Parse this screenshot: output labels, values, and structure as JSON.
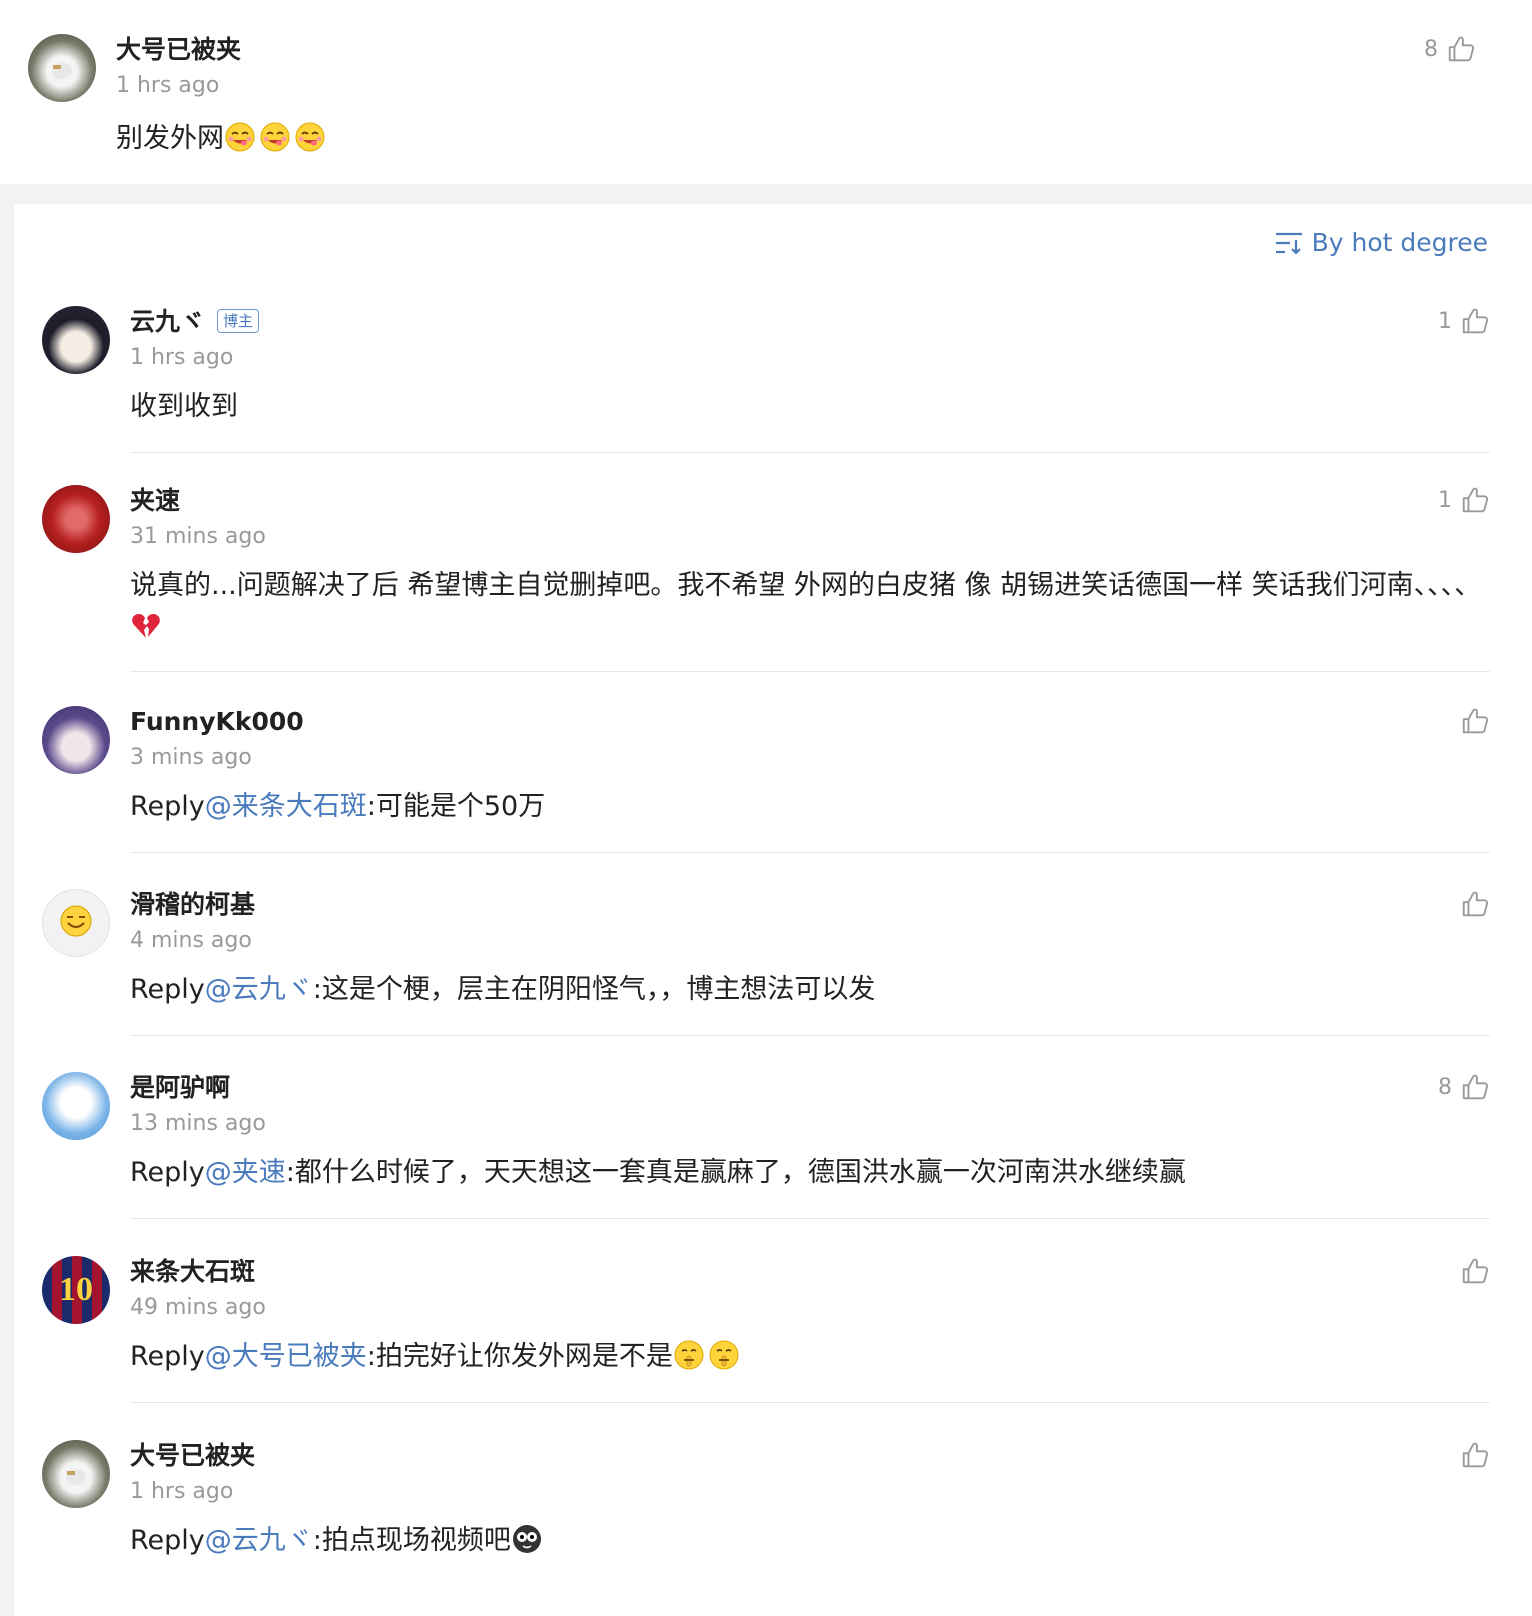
{
  "top_comment": {
    "username": "大号已被夹",
    "time": "1 hrs ago",
    "text": "别发外网",
    "likes": "8"
  },
  "sort": {
    "label": "By hot degree"
  },
  "comments": [
    {
      "username": "云九ヾ",
      "badge": "博主",
      "time": "1 hrs ago",
      "text": "收到收到",
      "likes": "1"
    },
    {
      "username": "夹速",
      "time": "31 mins ago",
      "text": "说真的...问题解决了后 希望博主自觉删掉吧。我不希望 外网的白皮猪 像 胡锡进笑话德国一样 笑话我们河南、、、、",
      "likes": "1"
    },
    {
      "username": "FunnyKk000",
      "time": "3 mins ago",
      "prefix": "Reply",
      "mention": "@来条大石斑",
      "text": ":可能是个50万",
      "likes": ""
    },
    {
      "username": "滑稽的柯基",
      "time": "4 mins ago",
      "prefix": "Reply",
      "mention": "@云九ヾ",
      "text": ":这是个梗，层主在阴阳怪气，，博主想法可以发",
      "likes": ""
    },
    {
      "username": "是阿驴啊",
      "time": "13 mins ago",
      "prefix": "Reply",
      "mention": "@夹速",
      "text": ":都什么时候了，天天想这一套真是赢麻了，德国洪水赢一次河南洪水继续赢",
      "likes": "8"
    },
    {
      "username": "来条大石斑",
      "time": "49 mins ago",
      "prefix": "Reply",
      "mention": "@大号已被夹",
      "text": ":拍完好让你发外网是不是",
      "likes": "",
      "avatar_text": "10"
    },
    {
      "username": "大号已被夹",
      "time": "1 hrs ago",
      "prefix": "Reply",
      "mention": "@云九ヾ",
      "text": ":拍点现场视频吧",
      "likes": ""
    }
  ],
  "colors": {
    "accent": "#4a7bbd",
    "muted": "#999999",
    "text": "#222222"
  },
  "icons": {
    "like": "thumbs-up-icon",
    "sort": "sort-lines-icon",
    "emoji_yummy": "yummy-face-emoji",
    "emoji_broken_heart": "broken-heart-emoji",
    "emoji_shush": "shushing-face-emoji",
    "emoji_spooky": "skull-eyes-emoji"
  }
}
